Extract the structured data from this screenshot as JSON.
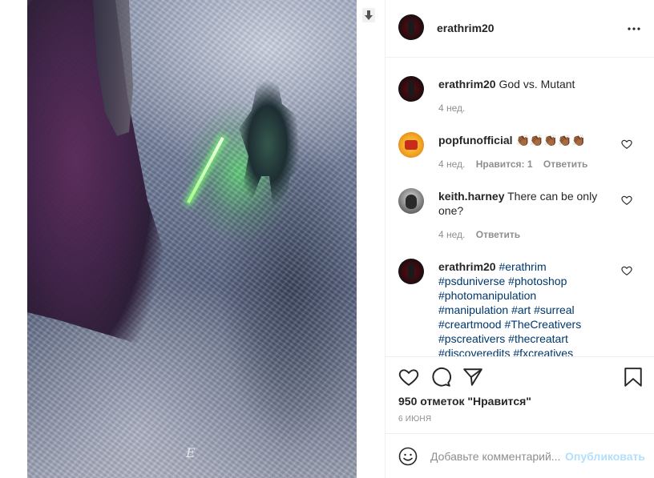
{
  "post": {
    "author": "erathrim20",
    "watermark": "E"
  },
  "caption": {
    "user": "erathrim20",
    "text": "God vs. Mutant",
    "time": "4 нед."
  },
  "comments": [
    {
      "user": "popfunofficial",
      "text": "👏🏾👏🏾👏🏾👏🏾👏🏾",
      "time": "4 нед.",
      "likes": "Нравится: 1",
      "reply": "Ответить"
    },
    {
      "user": "keith.harney",
      "text": "There can be only one?",
      "time": "4 нед.",
      "reply": "Ответить"
    },
    {
      "user": "erathrim20",
      "tags": [
        "#erathrim",
        "#psduniverse",
        "#photoshop",
        "#photomanipulation",
        "#manipulation",
        "#art",
        "#surreal",
        "#creartmood",
        "#TheCreativers",
        "#pscreativers",
        "#thecreatart",
        "#discoveredits",
        "#fxcreatives"
      ]
    }
  ],
  "stats": {
    "likes": "950 отметок \"Нравится\"",
    "date": "6 ИЮНЯ"
  },
  "comment_box": {
    "placeholder": "Добавьте комментарий...",
    "publish": "Опубликовать"
  },
  "icons": {
    "download": "download-icon",
    "more": "more-icon",
    "like": "heart-icon",
    "comment": "comment-icon",
    "share": "share-icon",
    "save": "bookmark-icon",
    "emoji": "emoji-icon"
  },
  "colors": {
    "link": "#00376b",
    "publish_disabled": "#b2dffc",
    "muted": "#8e8e8e",
    "text": "#262626"
  }
}
